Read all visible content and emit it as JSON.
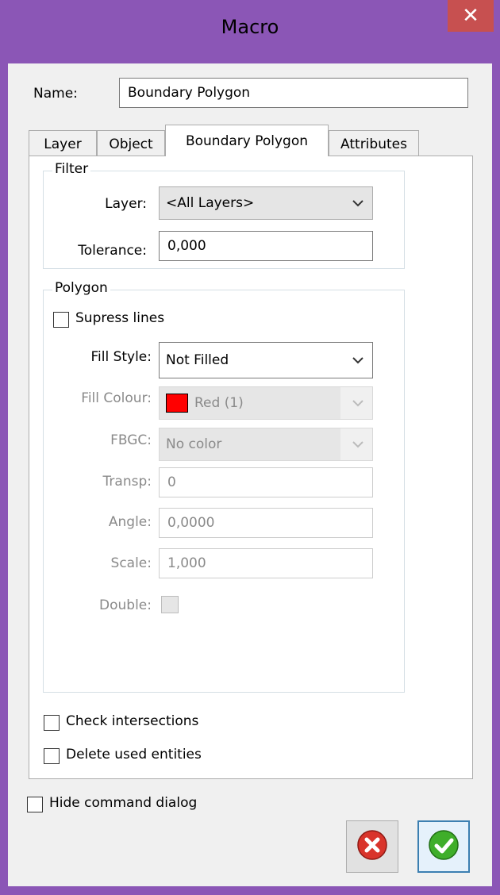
{
  "window": {
    "title": "Macro",
    "close_glyph": "✕"
  },
  "name_field": {
    "label": "Name:",
    "value": "Boundary Polygon"
  },
  "tabs": [
    {
      "label": "Layer"
    },
    {
      "label": "Object"
    },
    {
      "label": "Boundary Polygon"
    },
    {
      "label": "Attributes"
    }
  ],
  "filter": {
    "title": "Filter",
    "layer_label": "Layer:",
    "layer_value": "<All Layers>",
    "tolerance_label": "Tolerance:",
    "tolerance_value": "0,000"
  },
  "polygon": {
    "title": "Polygon",
    "supress_lines": "Supress lines",
    "fill_style_label": "Fill Style:",
    "fill_style_value": "Not Filled",
    "fill_colour_label": "Fill Colour:",
    "fill_colour_value": "Red (1)",
    "fill_colour_hex": "#ff0000",
    "fbgc_label": "FBGC:",
    "fbgc_value": "No color",
    "transp_label": "Transp:",
    "transp_value": "0",
    "angle_label": "Angle:",
    "angle_value": "0,0000",
    "scale_label": "Scale:",
    "scale_value": "1,000",
    "double_label": "Double:"
  },
  "options": {
    "check_intersections": "Check intersections",
    "delete_used": "Delete used entities"
  },
  "footer": {
    "hide_dialog": "Hide command dialog"
  },
  "colors": {
    "titlebar": "#8b56b6",
    "close_button": "#c75050",
    "cancel_red": "#d9342b",
    "ok_green": "#3fae2a"
  },
  "icons": {
    "cancel": "cancel-icon",
    "ok": "checkmark-icon"
  }
}
